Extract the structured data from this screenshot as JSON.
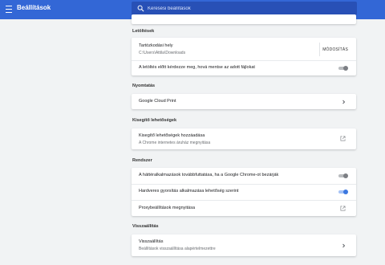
{
  "header": {
    "title": "Beállítások",
    "search_placeholder": "Keresési beállítások"
  },
  "sections": {
    "downloads": {
      "title": "Letöltések",
      "location_label": "Tartózkodási hely",
      "location_path": "C:\\Users\\Attila\\Downloads",
      "change_button": "MÓDOSÍTÁS",
      "ask_label": "A letöltés előtt kérdezze meg, hová mentse az adott fájlokat",
      "ask_enabled": false
    },
    "printing": {
      "title": "Nyomtatás",
      "cloud_print_label": "Google Cloud Print"
    },
    "accessibility": {
      "title": "Kisegítő lehetőségek",
      "add_label": "Kisegítő lehetőségek hozzáadása",
      "add_sub": "A Chrome internetes áruház megnyitása"
    },
    "system": {
      "title": "Rendszer",
      "background_label": "A háttéralkalmazások továbbfuttatása, ha a Google Chrome-ot bezárják",
      "background_enabled": false,
      "hw_accel_label": "Hardveres gyorsítás alkalmazása lehetőség szerint",
      "hw_accel_enabled": true,
      "proxy_label": "Proxybeállítások megnyitása"
    },
    "reset": {
      "title": "Visszaállítás",
      "reset_label": "Visszaállítás",
      "reset_sub": "Beállítások visszaállítása alapértelmezettre"
    }
  },
  "colors": {
    "header": "#3367d6",
    "toggle_on": "#3c78e0"
  },
  "icons": [
    "menu-icon",
    "search-icon",
    "chevron-right-icon",
    "open-external-icon"
  ]
}
